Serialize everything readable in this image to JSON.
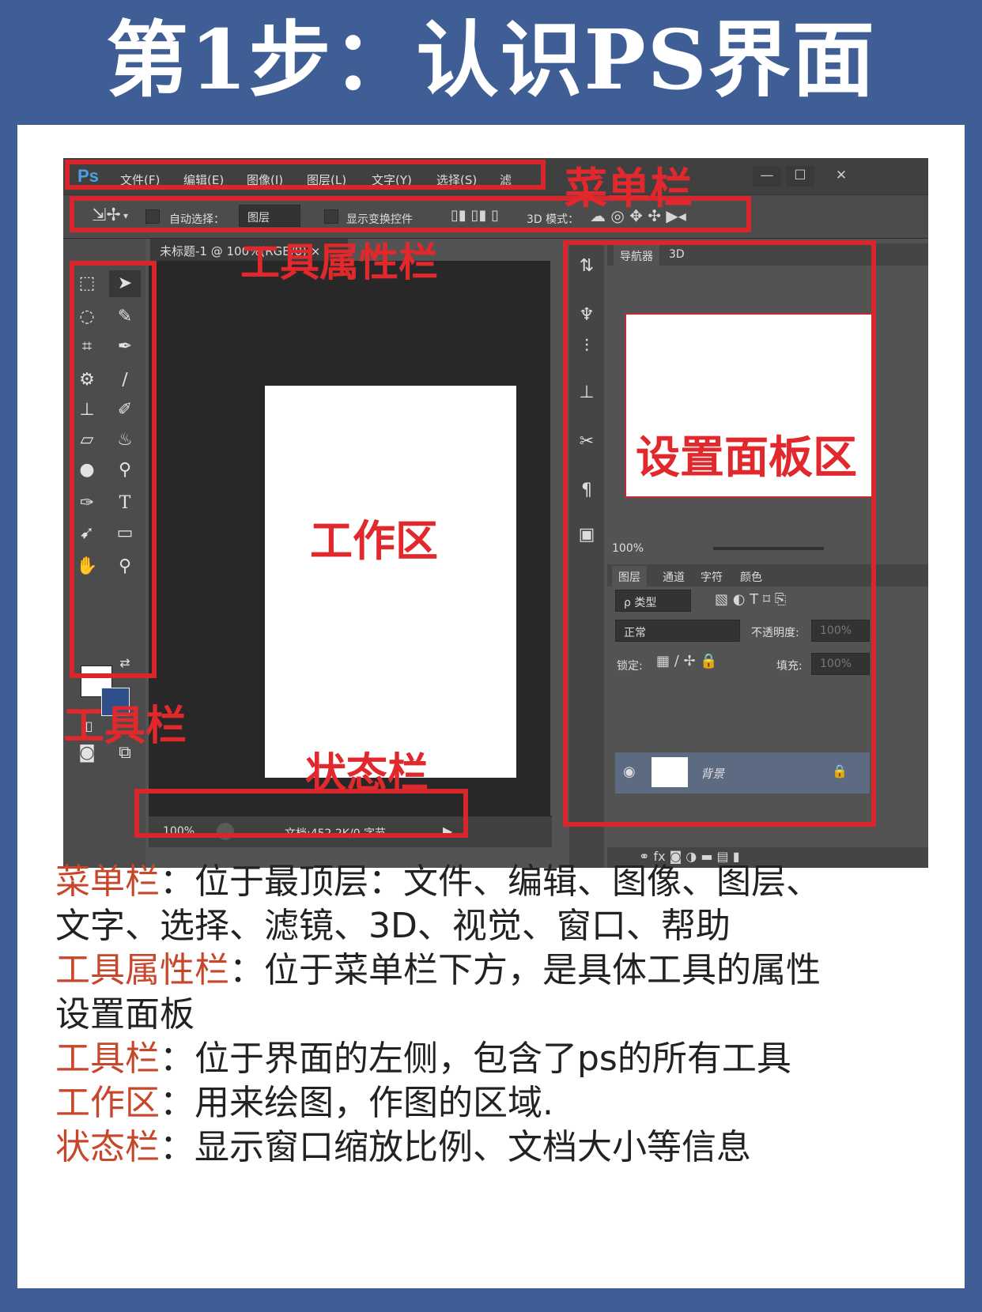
{
  "title": "第1步：认识PS界面",
  "menubar": {
    "logo": "Ps",
    "items": [
      "文件(F)",
      "编辑(E)",
      "图像(I)",
      "图层(L)",
      "文字(Y)",
      "选择(S)",
      "滤"
    ],
    "win": [
      "—",
      "☐",
      "✕"
    ]
  },
  "options": {
    "auto_select": "自动选择：",
    "layer_select": "图层",
    "show_transform": "显示变换控件",
    "mode_3d": "3D 模式："
  },
  "doc": {
    "tab": "未标题-1 @ 100%(RGB/8)",
    "tab_close": "×"
  },
  "status": {
    "zoom": "100%",
    "doc_info": "文档:452.2K/0 字节",
    "arrow": "▶"
  },
  "panel": {
    "tabs_top": [
      "导航器",
      "3D"
    ],
    "nav_zoom": "100%",
    "layer_tabs": [
      "图层",
      "通道",
      "字符",
      "颜色"
    ],
    "kind": "ρ 类型",
    "blend": "正常",
    "opacity_label": "不透明度:",
    "opacity_val": "100%",
    "lock_label": "锁定:",
    "fill_label": "填充:",
    "fill_val": "100%",
    "layer_name": "背景"
  },
  "labels": {
    "menubar": "菜单栏",
    "options": "工具属性栏",
    "toolbar": "工具栏",
    "status": "状态栏",
    "work": "工作区",
    "panel": "设置面板区"
  },
  "desc": [
    {
      "k": "菜单栏",
      "t": "：位于最顶层：文件、编辑、图像、图层、"
    },
    {
      "k": "",
      "t": "文字、选择、滤镜、3D、视觉、窗口、帮助"
    },
    {
      "k": "工具属性栏",
      "t": "：位于菜单栏下方，是具体工具的属性"
    },
    {
      "k": "",
      "t": "设置面板"
    },
    {
      "k": "工具栏",
      "t": "：位于界面的左侧，包含了ps的所有工具"
    },
    {
      "k": "工作区",
      "t": "：用来绘图，作图的区域."
    },
    {
      "k": "状态栏",
      "t": "：显示窗口缩放比例、文档大小等信息"
    }
  ]
}
